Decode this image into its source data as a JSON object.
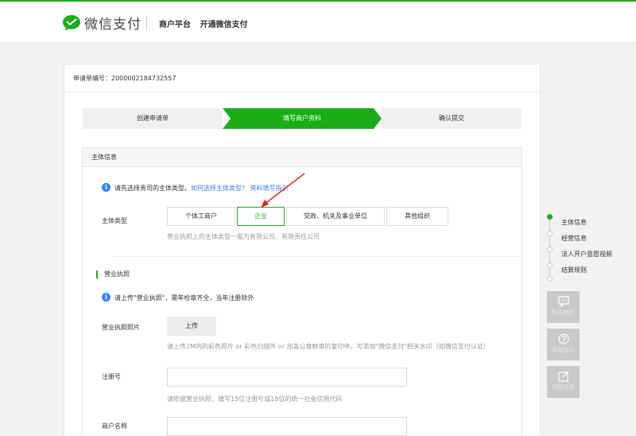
{
  "header": {
    "brand": "微信支付",
    "nav_items": [
      "商户平台",
      "开通微信支付"
    ],
    "accent_color": "#1aad19"
  },
  "application": {
    "number_label": "申请单编号：",
    "number_value": "2000002184732557"
  },
  "steps": [
    {
      "label": "创建申请单",
      "active": false
    },
    {
      "label": "填写商户资料",
      "active": true
    },
    {
      "label": "确认提交",
      "active": false
    }
  ],
  "subject_section": {
    "title": "主体信息",
    "notice_text": "请先选择贵司的主体类型。",
    "notice_links": "如何选择主体类型？ 资料填写指引",
    "type_label": "主体类型",
    "types": [
      {
        "label": "个体工商户",
        "selected": false
      },
      {
        "label": "企业",
        "selected": true
      },
      {
        "label": "党政、机关及事业单位",
        "selected": false
      },
      {
        "label": "其他组织",
        "selected": false
      }
    ],
    "type_help": "营业执照上的主体类型一般为有限公司、有限责任公司"
  },
  "license_section": {
    "title": "营业执照",
    "notice": "请上传\"营业执照\"，需年检章齐全，当年注册除外",
    "photo_label": "营业执照照片",
    "upload_button": "上传",
    "upload_help": "请上传2M内的彩色照片 or 彩色扫描件 or 加盖公章鲜章的复印件，可添加\"微信支付\"相关水印（如微信支付认证）",
    "reg_no_label": "注册号",
    "reg_no_value": "",
    "reg_no_help": "请依据营业执照，填写15位注册号或18位的统一社会信用代码",
    "merchant_name_label": "商户名称",
    "merchant_name_value": ""
  },
  "side_nav": {
    "items": [
      "主体信息",
      "经营信息",
      "法人开户意愿视频",
      "结算规则"
    ]
  },
  "float_buttons": [
    {
      "label": "联系我们",
      "icon": "chat-icon"
    },
    {
      "label": "帮助指引",
      "icon": "help-icon"
    },
    {
      "label": "问题反馈",
      "icon": "edit-icon"
    }
  ]
}
